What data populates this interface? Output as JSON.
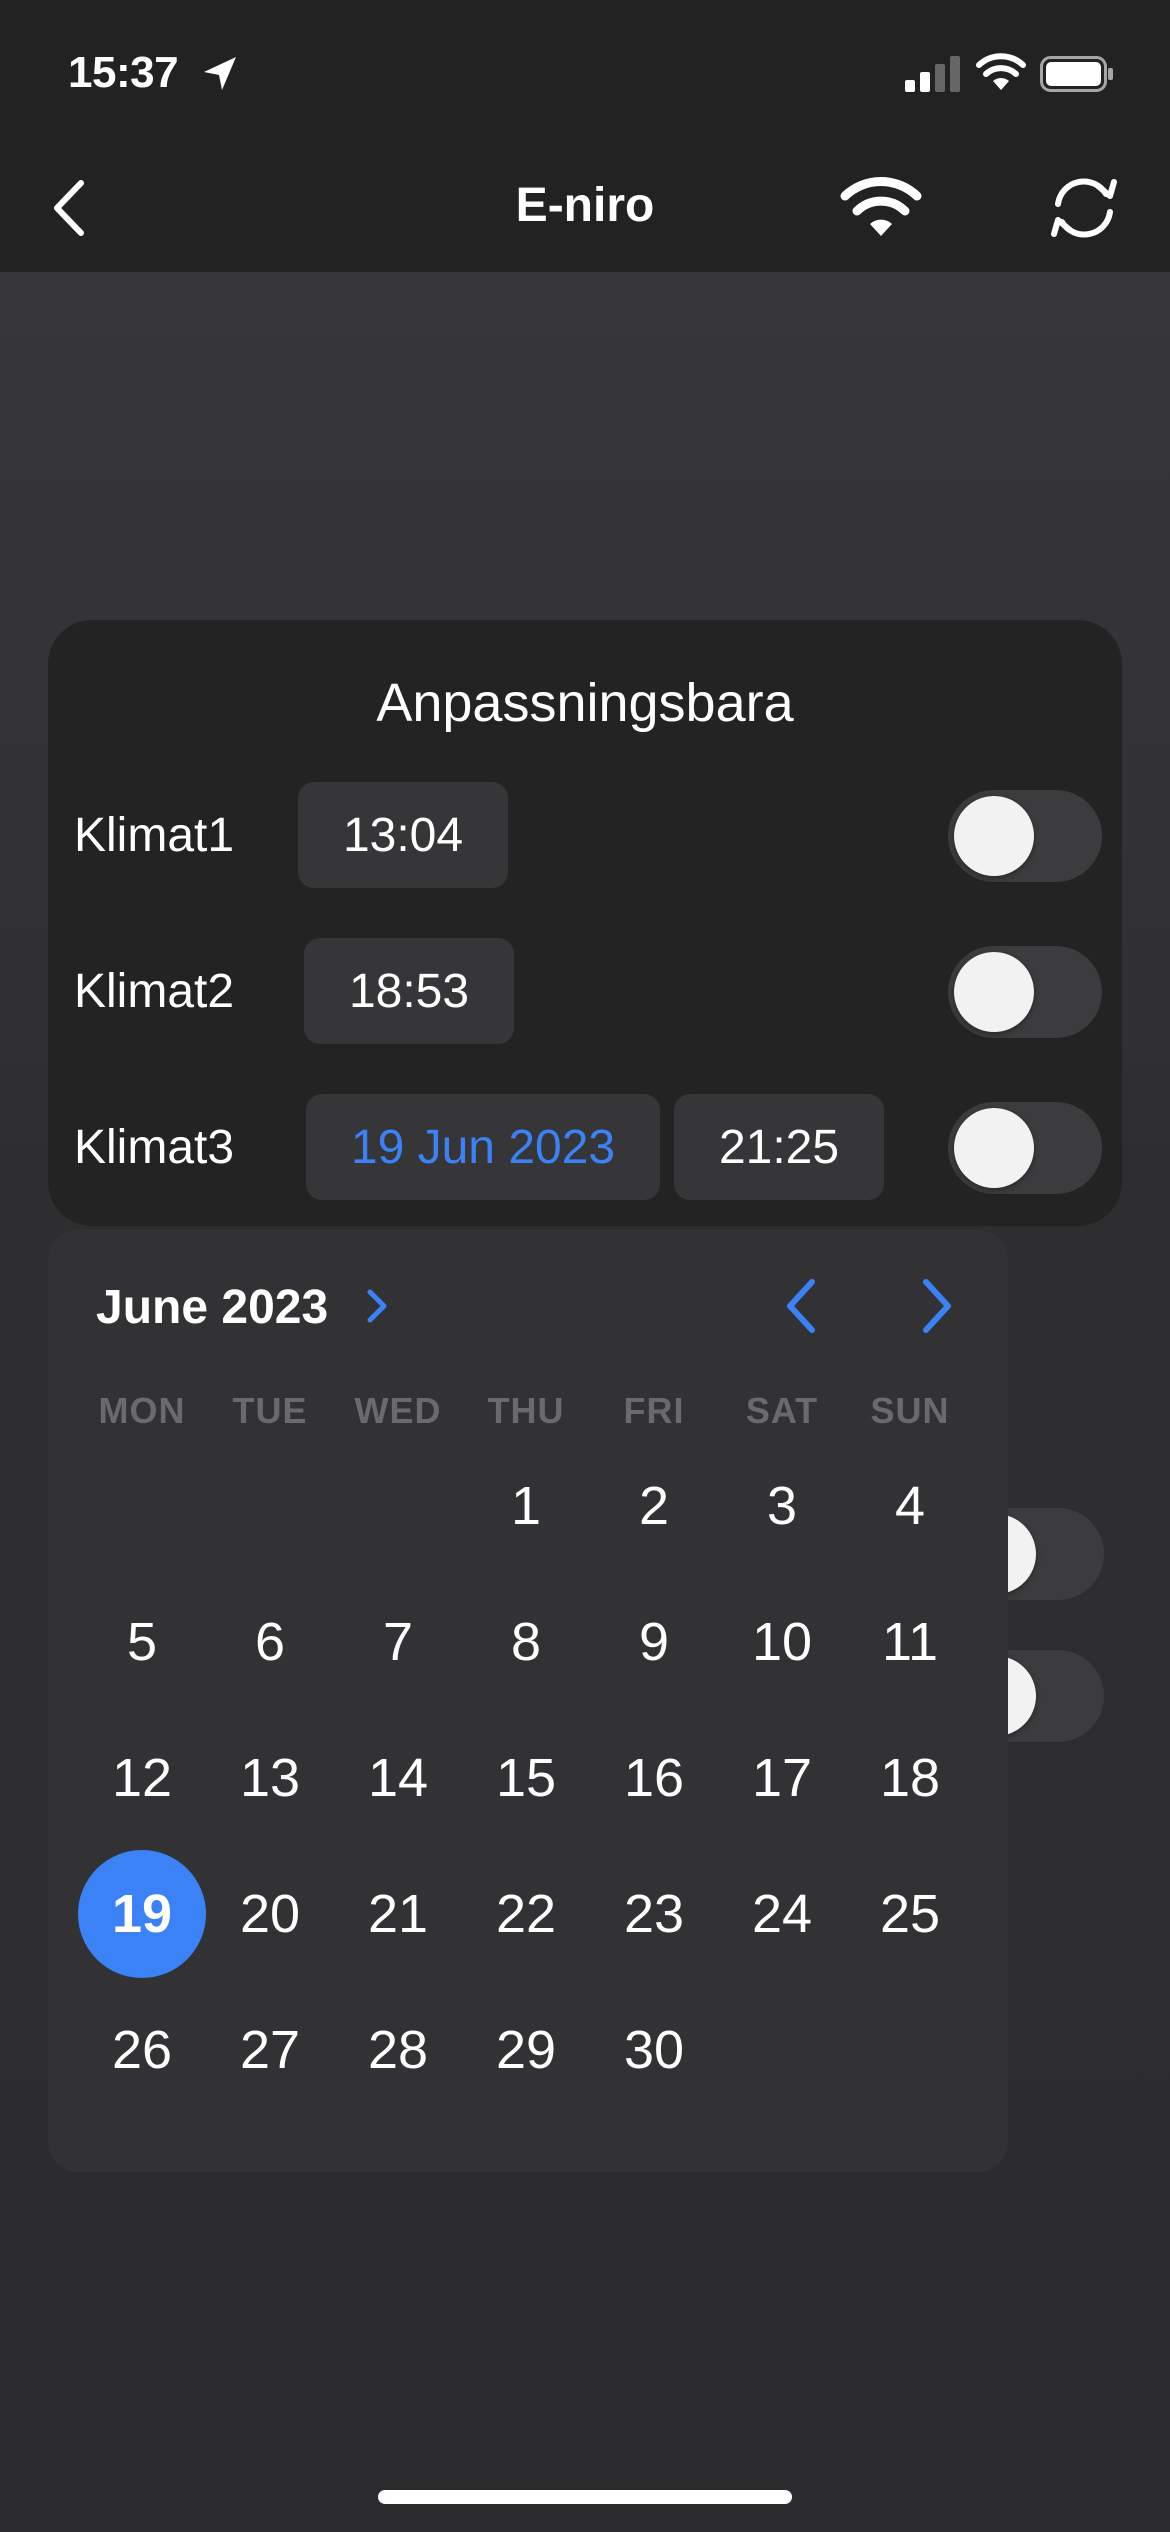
{
  "status_bar": {
    "time": "15:37"
  },
  "nav": {
    "title": "E-niro"
  },
  "card": {
    "title": "Anpassningsbara",
    "rows": [
      {
        "label": "Klimat1",
        "time": "13:04"
      },
      {
        "label": "Klimat2",
        "time": "18:53"
      },
      {
        "label": "Klimat3",
        "date": "19 Jun 2023",
        "time": "21:25"
      }
    ]
  },
  "calendar": {
    "month_label": "June 2023",
    "weekdays": [
      "MON",
      "TUE",
      "WED",
      "THU",
      "FRI",
      "SAT",
      "SUN"
    ],
    "days": [
      "1",
      "2",
      "3",
      "4",
      "5",
      "6",
      "7",
      "8",
      "9",
      "10",
      "11",
      "12",
      "13",
      "14",
      "15",
      "16",
      "17",
      "18",
      "19",
      "20",
      "21",
      "22",
      "23",
      "24",
      "25",
      "26",
      "27",
      "28",
      "29",
      "30"
    ],
    "selected_day": "19"
  },
  "colors": {
    "accent": "#3b82f6",
    "background": "#2c2c2e",
    "card": "#232324"
  }
}
